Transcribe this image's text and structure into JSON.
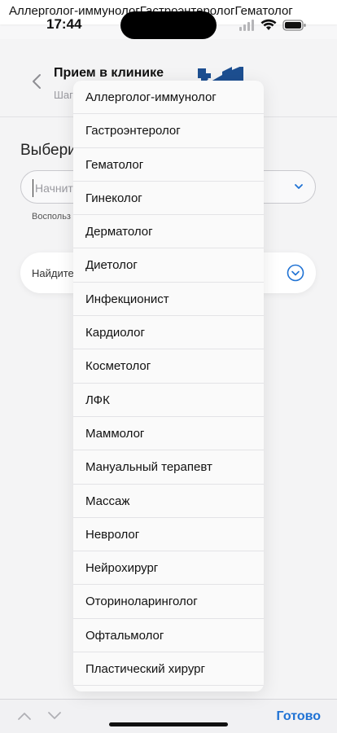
{
  "datalist_overlay": "Аллерголог-иммунологГастроэнтерологГематолог",
  "status_bar": {
    "time": "17:44"
  },
  "header": {
    "title": "Прием в клинике",
    "subtitle": "Шаг"
  },
  "form": {
    "section_title": "Выбери",
    "search_placeholder": "Начните",
    "hint": "Воспольз",
    "find_card_label": "Найдите"
  },
  "dropdown": {
    "items": [
      "Аллерголог-иммунолог",
      "Гастроэнтеролог",
      "Гематолог",
      "Гинеколог",
      "Дерматолог",
      "Диетолог",
      "Инфекционист",
      "Кардиолог",
      "Косметолог",
      "ЛФК",
      "Маммолог",
      "Мануальный терапевт",
      "Массаж",
      "Невролог",
      "Нейрохирург",
      "Оториноларинголог",
      "Офтальмолог",
      "Пластический хирург"
    ]
  },
  "accessory_bar": {
    "done_label": "Готово"
  },
  "colors": {
    "accent": "#1f72d4",
    "logo": "#1d4f91"
  }
}
